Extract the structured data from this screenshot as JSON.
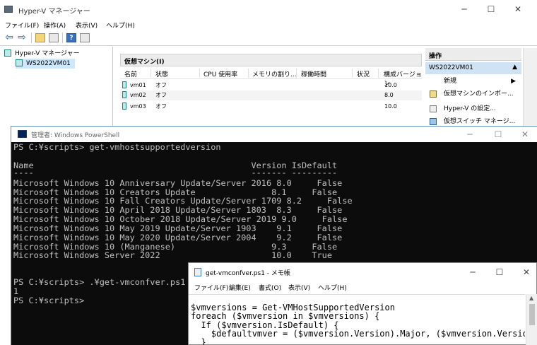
{
  "hyperv": {
    "title": "Hyper-V マネージャー",
    "menu": [
      "ファイル(F)",
      "操作(A)",
      "表示(V)",
      "ヘルプ(H)"
    ],
    "tree": {
      "root": "Hyper-V マネージャー",
      "server": "WS2022VM01"
    },
    "vm_panel": {
      "header": "仮想マシン(I)",
      "columns": [
        "名前",
        "状態",
        "CPU 使用率",
        "メモリの割り...",
        "稼働時間",
        "状況",
        "構成バージョン"
      ],
      "rows": [
        {
          "name": "vm01",
          "state": "オフ",
          "version": "10.0"
        },
        {
          "name": "vm02",
          "state": "オフ",
          "version": "8.0"
        },
        {
          "name": "vm03",
          "state": "オフ",
          "version": "10.0"
        }
      ]
    },
    "ops": {
      "header": "操作",
      "subheader": "WS2022VM01",
      "items": [
        "新規",
        "仮想マシンのインポー...",
        "Hyper-V の設定...",
        "仮想スイッチ マネージ..."
      ]
    }
  },
  "powershell": {
    "title": "管理者: Windows PowerShell",
    "lines": [
      "PS C:¥scripts> get-vmhostsupportedversion",
      "",
      "Name                                           Version IsDefault",
      "----                                           ------- ---------",
      "Microsoft Windows 10 Anniversary Update/Server 2016 8.0     False",
      "Microsoft Windows 10 Creators Update               8.1     False",
      "Microsoft Windows 10 Fall Creators Update/Server 1709 8.2     False",
      "Microsoft Windows 10 April 2018 Update/Server 1803  8.3     False",
      "Microsoft Windows 10 October 2018 Update/Server 2019 9.0     False",
      "Microsoft Windows 10 May 2019 Update/Server 1903    9.1     False",
      "Microsoft Windows 10 May 2020 Update/Server 2004    9.2     False",
      "Microsoft Windows 10 (Manganese)                   9.3     False",
      "Microsoft Windows Server 2022                      10.0    True",
      "",
      "",
      "PS C:¥scripts> .¥get-vmconfver.ps1",
      "1",
      "PS C:¥scripts>"
    ]
  },
  "notepad": {
    "title": "get-vmconfver.ps1 - メモ帳",
    "menu": [
      "ファイル(F)",
      "編集(E)",
      "書式(O)",
      "表示(V)",
      "ヘルプ(H)"
    ],
    "lines": [
      "$vmversions = Get-VMHostSupportedVersion",
      "foreach ($vmversion in $vmversions) {",
      "  If ($vmversion.IsDefault) {",
      "    $defaultvmver = ($vmversion.Version).Major, ($vmversion.Version).Minor -",
      "  }"
    ]
  }
}
